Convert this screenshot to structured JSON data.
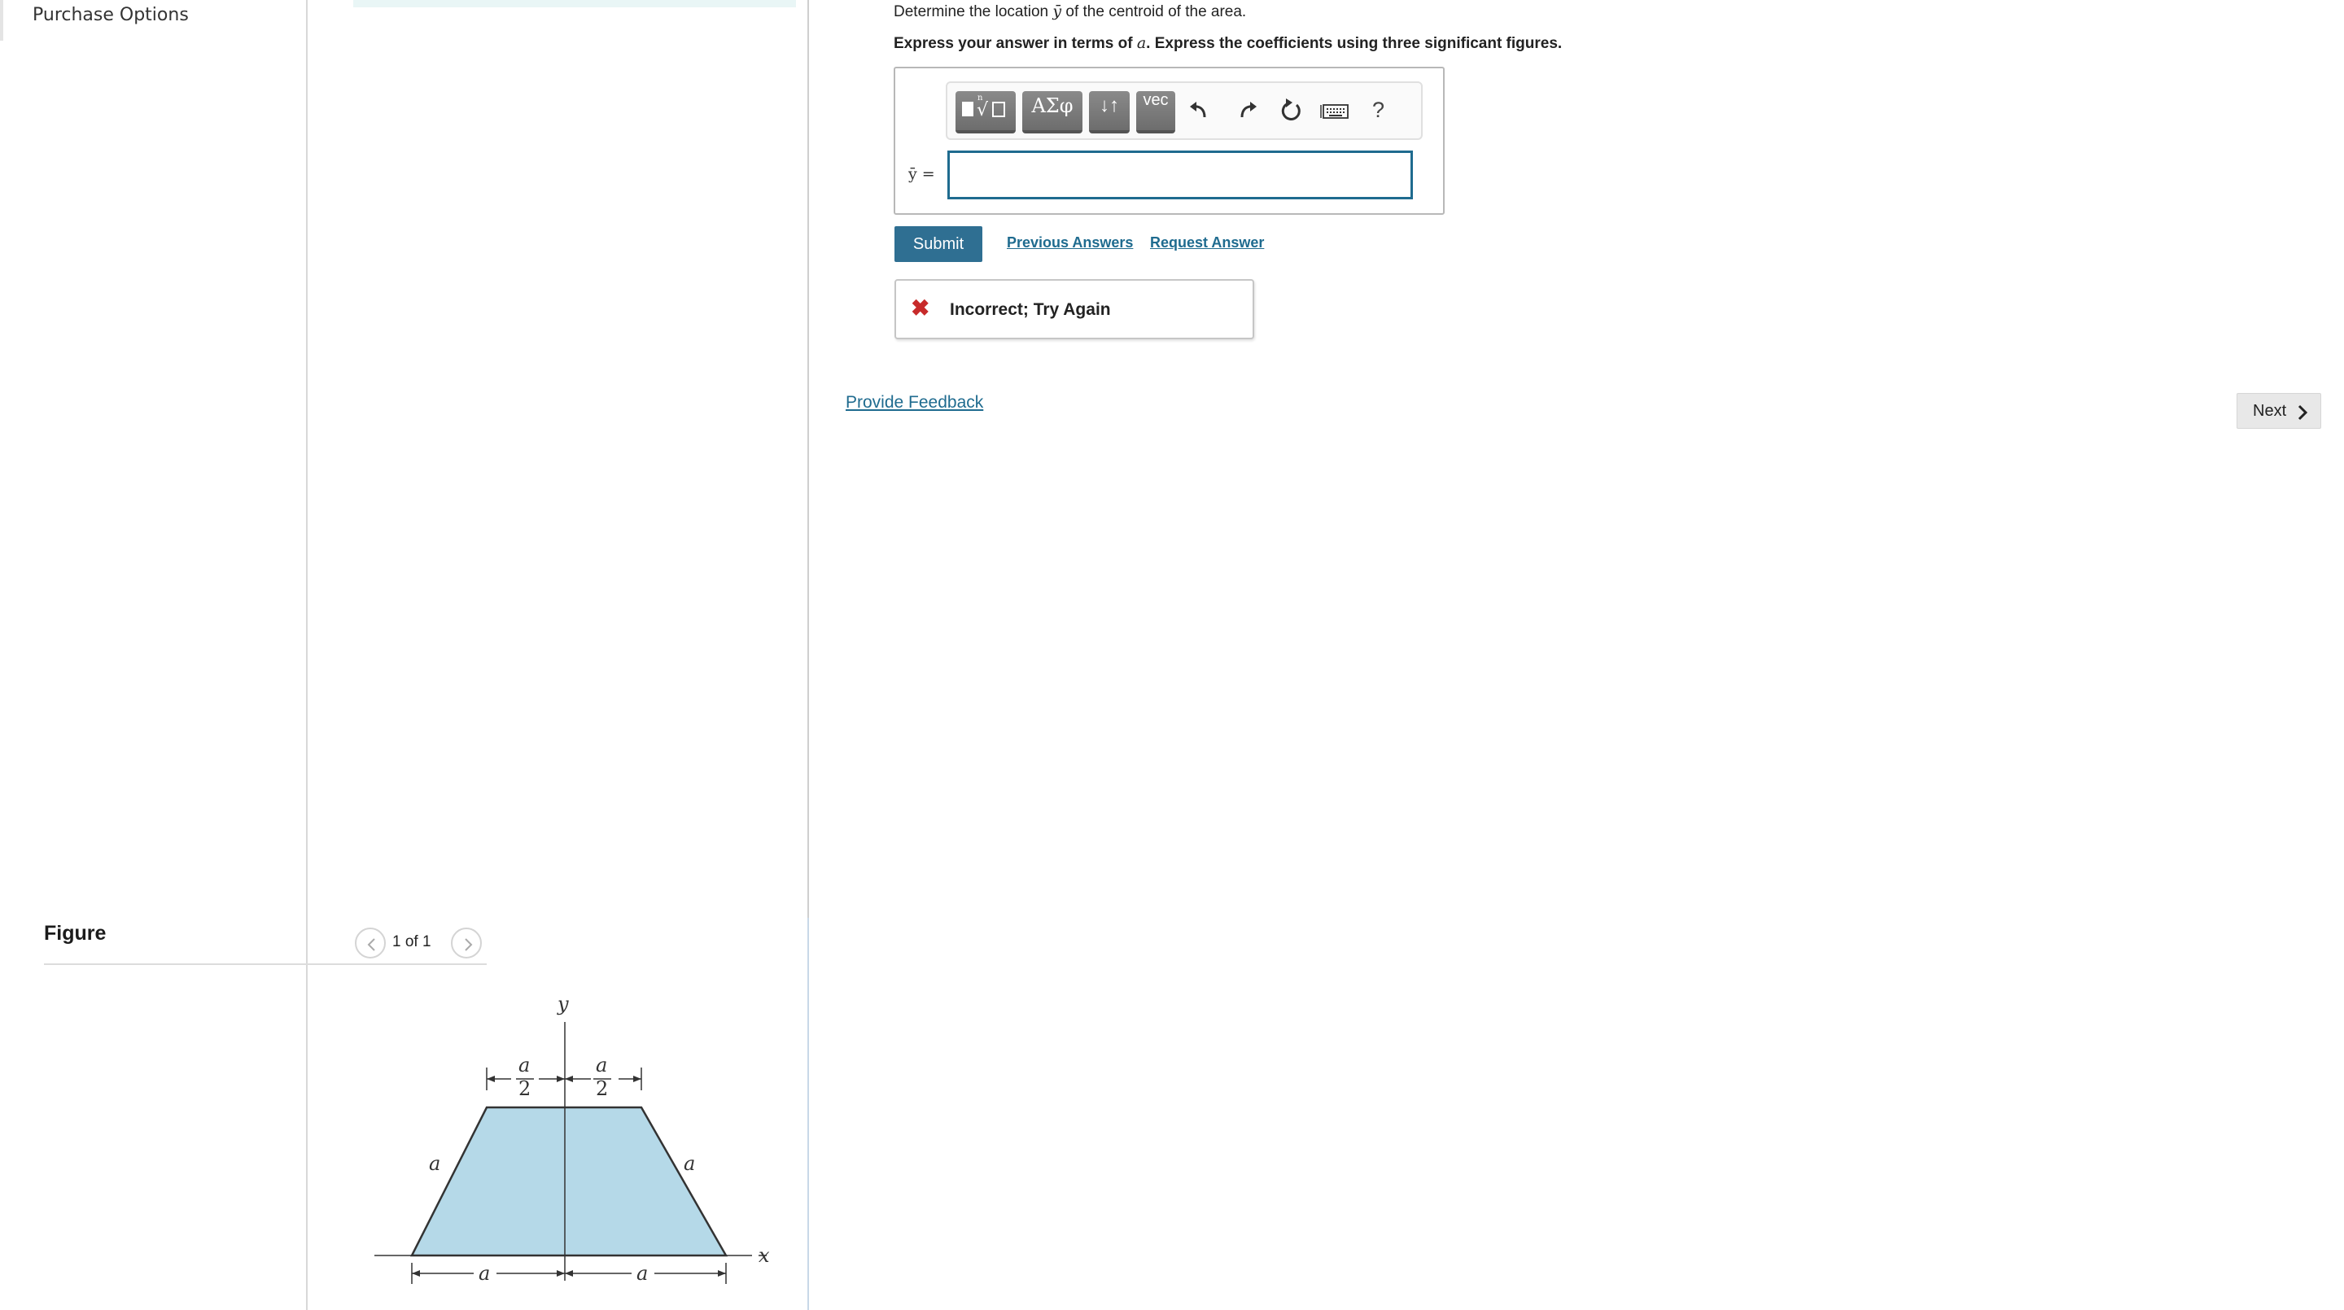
{
  "left_nav": {
    "purchase_options": "Purchase Options"
  },
  "figure": {
    "title": "Figure",
    "pager": "1 of 1",
    "labels": {
      "y_axis": "y",
      "x_axis": "x",
      "a": "a",
      "half_numerator": "a",
      "half_denominator": "2"
    },
    "fill_color": "#b5d9e8"
  },
  "question": {
    "prompt_before": "Determine the location ",
    "prompt_symbol": "ȳ",
    "prompt_after": " of the centroid of the area.",
    "instruction_before": "Express your answer in terms of ",
    "instruction_symbol": "a",
    "instruction_after": ". Express the coefficients using three significant figures."
  },
  "toolbar": {
    "templates_icon": "templates-icon",
    "greek_label": "ΑΣφ",
    "arrows_label": "↓↑",
    "vec_label": "vec",
    "undo_icon": "undo-icon",
    "redo_icon": "redo-icon",
    "reset_icon": "reset-icon",
    "keyboard_icon": "keyboard-icon",
    "help_label": "?"
  },
  "answer": {
    "variable_label": "ȳ =",
    "input_value": ""
  },
  "actions": {
    "submit": "Submit",
    "previous_answers": "Previous Answers",
    "request_answer": "Request Answer"
  },
  "feedback": {
    "icon": "✖",
    "text": "Incorrect; Try Again",
    "color": "#c72a2a"
  },
  "provide_feedback": "Provide Feedback",
  "next": "Next",
  "colors": {
    "accent": "#2f6f92",
    "link": "#1f6b8f"
  }
}
